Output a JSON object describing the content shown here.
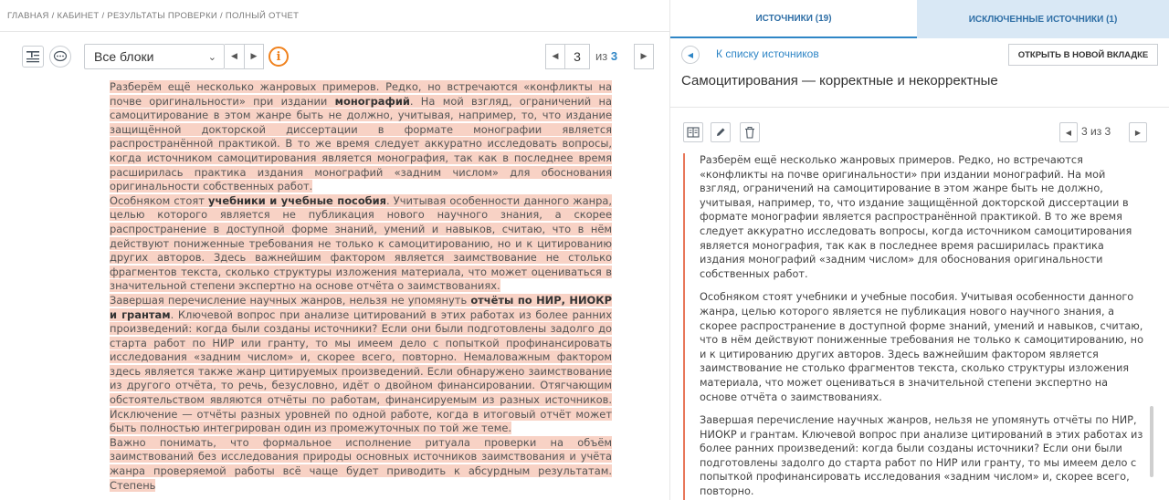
{
  "breadcrumb": "ГЛАВНАЯ / КАБИНЕТ / РЕЗУЛЬТАТЫ ПРОВЕРКИ / ПОЛНЫЙ ОТЧЕТ",
  "toolbar": {
    "block_select_value": "Все блоки",
    "current_page": "3",
    "page_of_label": "из",
    "total_pages": "3"
  },
  "document": {
    "p1": [
      {
        "t": "Разберём ещё несколько жанровых примеров. Редко, но встречаются «конфликты на почве оригинальности» при издании "
      },
      {
        "t": "монографий",
        "b": true
      },
      {
        "t": ". На мой взгляд, ограничений на самоцитирование в этом жанре быть не должно, учитывая, например, то, что издание защищённой докторской диссертации в формате монографии является распространённой практикой. В то же время следует аккуратно исследовать вопросы, когда источником самоцитирования является монография, так как в последнее время расширилась практика издания монографий «задним числом» для обоснования оригинальности собственных работ."
      }
    ],
    "p2": [
      {
        "t": "Особняком стоят "
      },
      {
        "t": "учебники и учебные пособия",
        "b": true
      },
      {
        "t": ". Учитывая особенности данного жанра, целью которого является не публикация нового научного знания, а скорее распространение в доступной форме знаний, умений и навыков, считаю, что в нём действуют пониженные требования не только к самоцитированию, но и к цитированию других авторов. Здесь важнейшим фактором является заимствование не столько фрагментов текста, сколько структуры изложения материала, что может оцениваться в значительной степени экспертно на основе отчёта о заимствованиях."
      }
    ],
    "p3": [
      {
        "t": "Завершая перечисление научных жанров, нельзя не упомянуть "
      },
      {
        "t": "отчёты по НИР, НИОКР и грантам",
        "b": true
      },
      {
        "t": ". Ключевой вопрос при анализе цитирований в этих работах из более ранних произведений: когда были созданы источники? Если они были подготовлены задолго до старта работ по НИР или гранту, то мы имеем дело с попыткой профинансировать исследования «задним числом» и, скорее всего, повторно. Немаловажным фактором здесь является также жанр цитируемых произведений. Если обнаружено заимствование из другого отчёта, то речь, безусловно, идёт о двойном финансировании. Отягчающим обстоятельством являются отчёты по работам, финансируемым из разных источников. Исключение — отчёты разных уровней по одной работе, когда в итоговый отчёт может быть полностью интегрирован один из промежуточных по той же теме."
      }
    ],
    "p4": [
      {
        "t": "Важно понимать, что формальное исполнение ритуала проверки на объём заимствований без исследования природы основных источников заимствования и учёта жанра проверяемой работы всё чаще будет приводить к абсурдным результатам. Степень"
      }
    ]
  },
  "right": {
    "tab_sources": "ИСТОЧНИКИ (19)",
    "tab_excluded": "ИСКЛЮЧЕННЫЕ ИСТОЧНИКИ (1)",
    "back_link": "К списку источников",
    "open_new_tab": "ОТКРЫТЬ В НОВОЙ ВКЛАДКЕ",
    "source_title": "Самоцитирования — корректные и некорректные",
    "match_count": "3 из 3",
    "paragraphs": [
      "Разберём ещё несколько жанровых примеров. Редко, но встречаются «конфликты на почве оригинальности» при издании монографий. На мой взгляд, ограничений на самоцитирование в этом жанре быть не должно, учитывая, например, то, что издание защищённой докторской диссертации в формате монографии является распространённой практикой. В то же время следует аккуратно исследовать вопросы, когда источником самоцитирования является монография, так как в последнее время расширилась практика издания монографий «задним числом» для обоснования оригинальности собственных работ.",
      "Особняком стоят учебники и учебные пособия. Учитывая особенности данного жанра, целью которого является не публикация нового научного знания, а скорее распространение в доступной форме знаний, умений и навыков, считаю, что в нём действуют пониженные требования не только к самоцитированию, но и к цитированию других авторов. Здесь важнейшим фактором является заимствование не столько фрагментов текста, сколько структуры изложения материала, что может оцениваться в значительной степени экспертно на основе отчёта о заимствованиях.",
      "Завершая перечисление научных жанров, нельзя не упомянуть отчёты по НИР, НИОКР и грантам. Ключевой вопрос при анализе цитирований в этих работах из более ранних произведений: когда были созданы источники? Если они были подготовлены задолго до старта работ по НИР или гранту, то мы имеем дело с попыткой профинансировать исследования «задним числом» и, скорее всего, повторно."
    ]
  },
  "colors": {
    "accent": "#2f86c6",
    "highlight": "#f8d2c5",
    "info": "#f0821e",
    "source_border": "#e8775a",
    "excluded_tab_bg": "#d9e8f5"
  },
  "icons": {
    "text_view": "text-view-icon",
    "comments": "comments-icon",
    "info": "info-icon",
    "book": "book-icon",
    "edit": "pencil-icon",
    "trash": "trash-icon",
    "back": "chevron-left-icon"
  }
}
